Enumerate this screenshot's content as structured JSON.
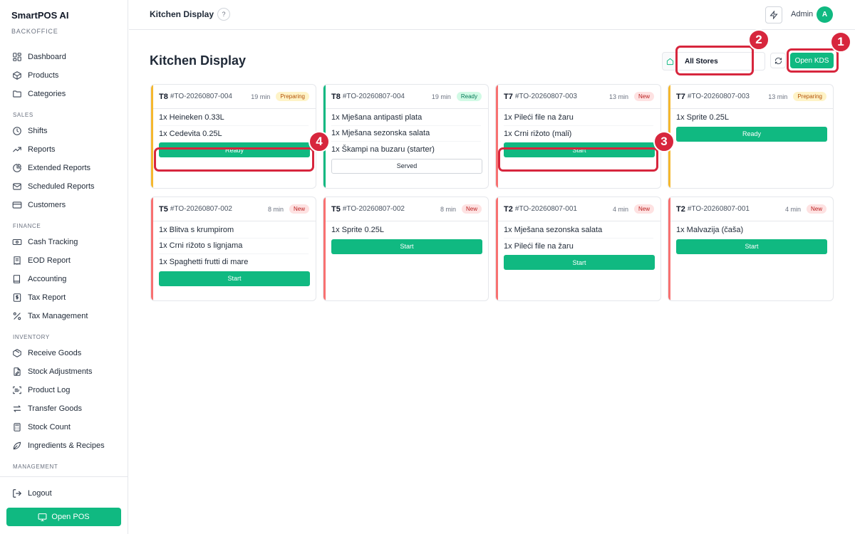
{
  "brand": {
    "name": "SmartPOS AI",
    "subtitle": "BACKOFFICE"
  },
  "sidebar": {
    "items": [
      {
        "type": "item",
        "label": "Dashboard",
        "icon": "grid-icon"
      },
      {
        "type": "item",
        "label": "Products",
        "icon": "box-icon"
      },
      {
        "type": "item",
        "label": "Categories",
        "icon": "folder-icon"
      },
      {
        "type": "section",
        "label": "SALES"
      },
      {
        "type": "item",
        "label": "Shifts",
        "icon": "clock-icon"
      },
      {
        "type": "item",
        "label": "Reports",
        "icon": "trending-icon"
      },
      {
        "type": "item",
        "label": "Extended Reports",
        "icon": "pie-icon"
      },
      {
        "type": "item",
        "label": "Scheduled Reports",
        "icon": "mail-icon"
      },
      {
        "type": "item",
        "label": "Customers",
        "icon": "card-icon"
      },
      {
        "type": "section",
        "label": "FINANCE"
      },
      {
        "type": "item",
        "label": "Cash Tracking",
        "icon": "cash-icon"
      },
      {
        "type": "item",
        "label": "EOD Report",
        "icon": "receipt-icon"
      },
      {
        "type": "item",
        "label": "Accounting",
        "icon": "book-icon"
      },
      {
        "type": "item",
        "label": "Tax Report",
        "icon": "dollar-doc-icon"
      },
      {
        "type": "item",
        "label": "Tax Management",
        "icon": "percent-icon"
      },
      {
        "type": "section",
        "label": "INVENTORY"
      },
      {
        "type": "item",
        "label": "Receive Goods",
        "icon": "package-icon"
      },
      {
        "type": "item",
        "label": "Stock Adjustments",
        "icon": "edit-doc-icon"
      },
      {
        "type": "item",
        "label": "Product Log",
        "icon": "scan-icon"
      },
      {
        "type": "item",
        "label": "Transfer Goods",
        "icon": "transfer-icon"
      },
      {
        "type": "item",
        "label": "Stock Count",
        "icon": "calculator-icon"
      },
      {
        "type": "item",
        "label": "Ingredients & Recipes",
        "icon": "leaf-icon"
      },
      {
        "type": "section",
        "label": "MANAGEMENT"
      }
    ],
    "logout": "Logout",
    "open_pos": "Open POS"
  },
  "topbar": {
    "title": "Kitchen Display",
    "help": "?",
    "user": "Admin",
    "avatar": "A"
  },
  "page": {
    "title": "Kitchen Display",
    "store_filter": "All Stores",
    "open_kds": "Open KDS"
  },
  "colors": {
    "accent": "#10b981",
    "preparing": "#f5b82e",
    "ready": "#10b981",
    "new": "#f87171"
  },
  "orders": [
    {
      "table": "T8",
      "order": "#TO-20260807-004",
      "time": "19 min",
      "status": "Preparing",
      "status_key": "preparing",
      "items": [
        "1x Heineken 0.33L",
        "1x Cedevita 0.25L"
      ],
      "action": "Ready",
      "action_style": "primary"
    },
    {
      "table": "T8",
      "order": "#TO-20260807-004",
      "time": "19 min",
      "status": "Ready",
      "status_key": "ready",
      "items": [
        "1x Mješana antipasti plata",
        "1x Mješana sezonska salata",
        "1x Škampi na buzaru (starter)"
      ],
      "action": "Served",
      "action_style": "outline"
    },
    {
      "table": "T7",
      "order": "#TO-20260807-003",
      "time": "13 min",
      "status": "New",
      "status_key": "new",
      "items": [
        "1x Pileći file na žaru",
        "1x Crni rižoto (mali)"
      ],
      "action": "Start",
      "action_style": "primary"
    },
    {
      "table": "T7",
      "order": "#TO-20260807-003",
      "time": "13 min",
      "status": "Preparing",
      "status_key": "preparing",
      "items": [
        "1x Sprite 0.25L"
      ],
      "action": "Ready",
      "action_style": "primary"
    },
    {
      "table": "T5",
      "order": "#TO-20260807-002",
      "time": "8 min",
      "status": "New",
      "status_key": "new",
      "items": [
        "1x Blitva s krumpirom",
        "1x Crni rižoto s lignjama",
        "1x Spaghetti frutti di mare"
      ],
      "action": "Start",
      "action_style": "primary"
    },
    {
      "table": "T5",
      "order": "#TO-20260807-002",
      "time": "8 min",
      "status": "New",
      "status_key": "new",
      "items": [
        "1x Sprite 0.25L"
      ],
      "action": "Start",
      "action_style": "primary"
    },
    {
      "table": "T2",
      "order": "#TO-20260807-001",
      "time": "4 min",
      "status": "New",
      "status_key": "new",
      "items": [
        "1x Mješana sezonska salata",
        "1x Pileći file na žaru"
      ],
      "action": "Start",
      "action_style": "primary"
    },
    {
      "table": "T2",
      "order": "#TO-20260807-001",
      "time": "4 min",
      "status": "New",
      "status_key": "new",
      "items": [
        "1x Malvazija (čaša)"
      ],
      "action": "Start",
      "action_style": "primary"
    }
  ],
  "callouts": [
    "1",
    "2",
    "3",
    "4"
  ]
}
